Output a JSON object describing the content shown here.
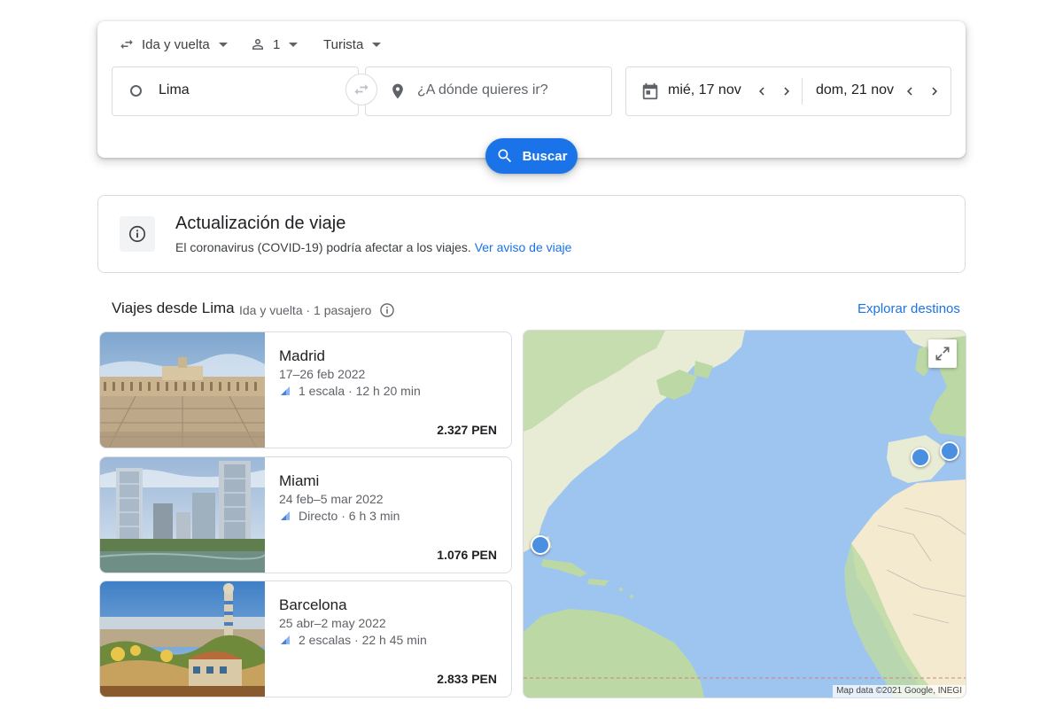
{
  "search": {
    "trip_type": "Ida y vuelta",
    "passengers": "1",
    "cabin_class": "Turista",
    "origin": "Lima",
    "destination_placeholder": "¿A dónde quieres ir?",
    "depart_date": "mié, 17 nov",
    "return_date": "dom, 21 nov",
    "search_button": "Buscar"
  },
  "notice": {
    "title": "Actualización de viaje",
    "body": "El coronavirus (COVID-19) podría afectar a los viajes.",
    "link": "Ver aviso de viaje"
  },
  "section": {
    "title": "Viajes desde Lima",
    "subtitle": "Ida y vuelta · 1 pasajero",
    "explore_link": "Explorar destinos"
  },
  "destinations": [
    {
      "city": "Madrid",
      "dates": "17–26 feb 2022",
      "stops": "1 escala · 12 h 20 min",
      "price": "2.327 PEN"
    },
    {
      "city": "Miami",
      "dates": "24 feb–5 mar 2022",
      "stops": "Directo · 6 h 3 min",
      "price": "1.076 PEN"
    },
    {
      "city": "Barcelona",
      "dates": "25 abr–2 may 2022",
      "stops": "2 escalas · 22 h 45 min",
      "price": "2.833 PEN"
    }
  ],
  "map": {
    "attribution": "Map data ©2021 Google, INEGI",
    "colors": {
      "ocean": "#9ec5f0",
      "land": "#e8ecd5",
      "vegetation": "#bcd9a5",
      "desert": "#f3ead0",
      "pin": "#4a8fe0"
    }
  },
  "colors": {
    "accent": "#1a73e8",
    "text": "#202124",
    "secondary_text": "#5f6368",
    "border": "#dadce0"
  }
}
